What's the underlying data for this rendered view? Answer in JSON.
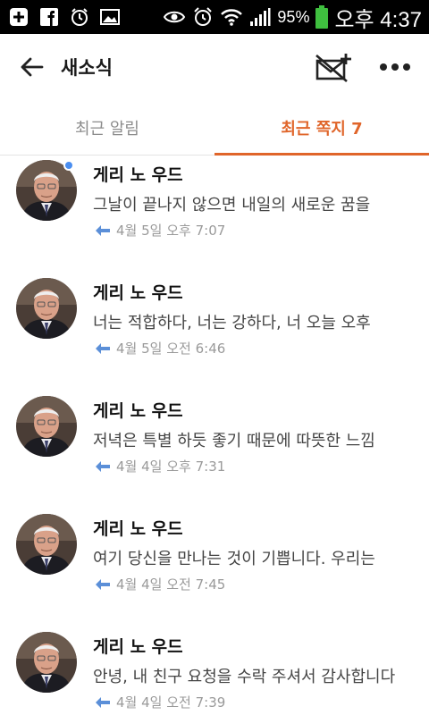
{
  "status_bar": {
    "battery": "95%",
    "time": "오후 4:37"
  },
  "header": {
    "title": "새소식"
  },
  "tabs": [
    {
      "label": "최근 알림",
      "active": false
    },
    {
      "label": "최근 쪽지 7",
      "active": true
    }
  ],
  "messages": [
    {
      "sender": "게리 노 우드",
      "preview": "그날이 끝나지 않으면 내일의 새로운 꿈을",
      "time": "4월 5일 오후 7:07",
      "unread": true
    },
    {
      "sender": "게리 노 우드",
      "preview": "너는 적합하다, 너는 강하다, 너 오늘 오후",
      "time": "4월 5일 오전 6:46",
      "unread": false
    },
    {
      "sender": "게리 노 우드",
      "preview": "저녁은 특별 하듯 좋기 때문에 따뜻한 느낌",
      "time": "4월 4일 오후 7:31",
      "unread": false
    },
    {
      "sender": "게리 노 우드",
      "preview": "여기 당신을 만나는 것이 기쁩니다. 우리는",
      "time": "4월 4일 오전 7:45",
      "unread": false
    },
    {
      "sender": "게리 노 우드",
      "preview": "안녕, 내 친구 요청을 수락 주셔서 감사합니다",
      "time": "4월 4일 오전 7:39",
      "unread": false
    }
  ],
  "colors": {
    "accent": "#e0652a",
    "unread_dot": "#4a8ef0",
    "reply_icon": "#5b8fd8"
  }
}
